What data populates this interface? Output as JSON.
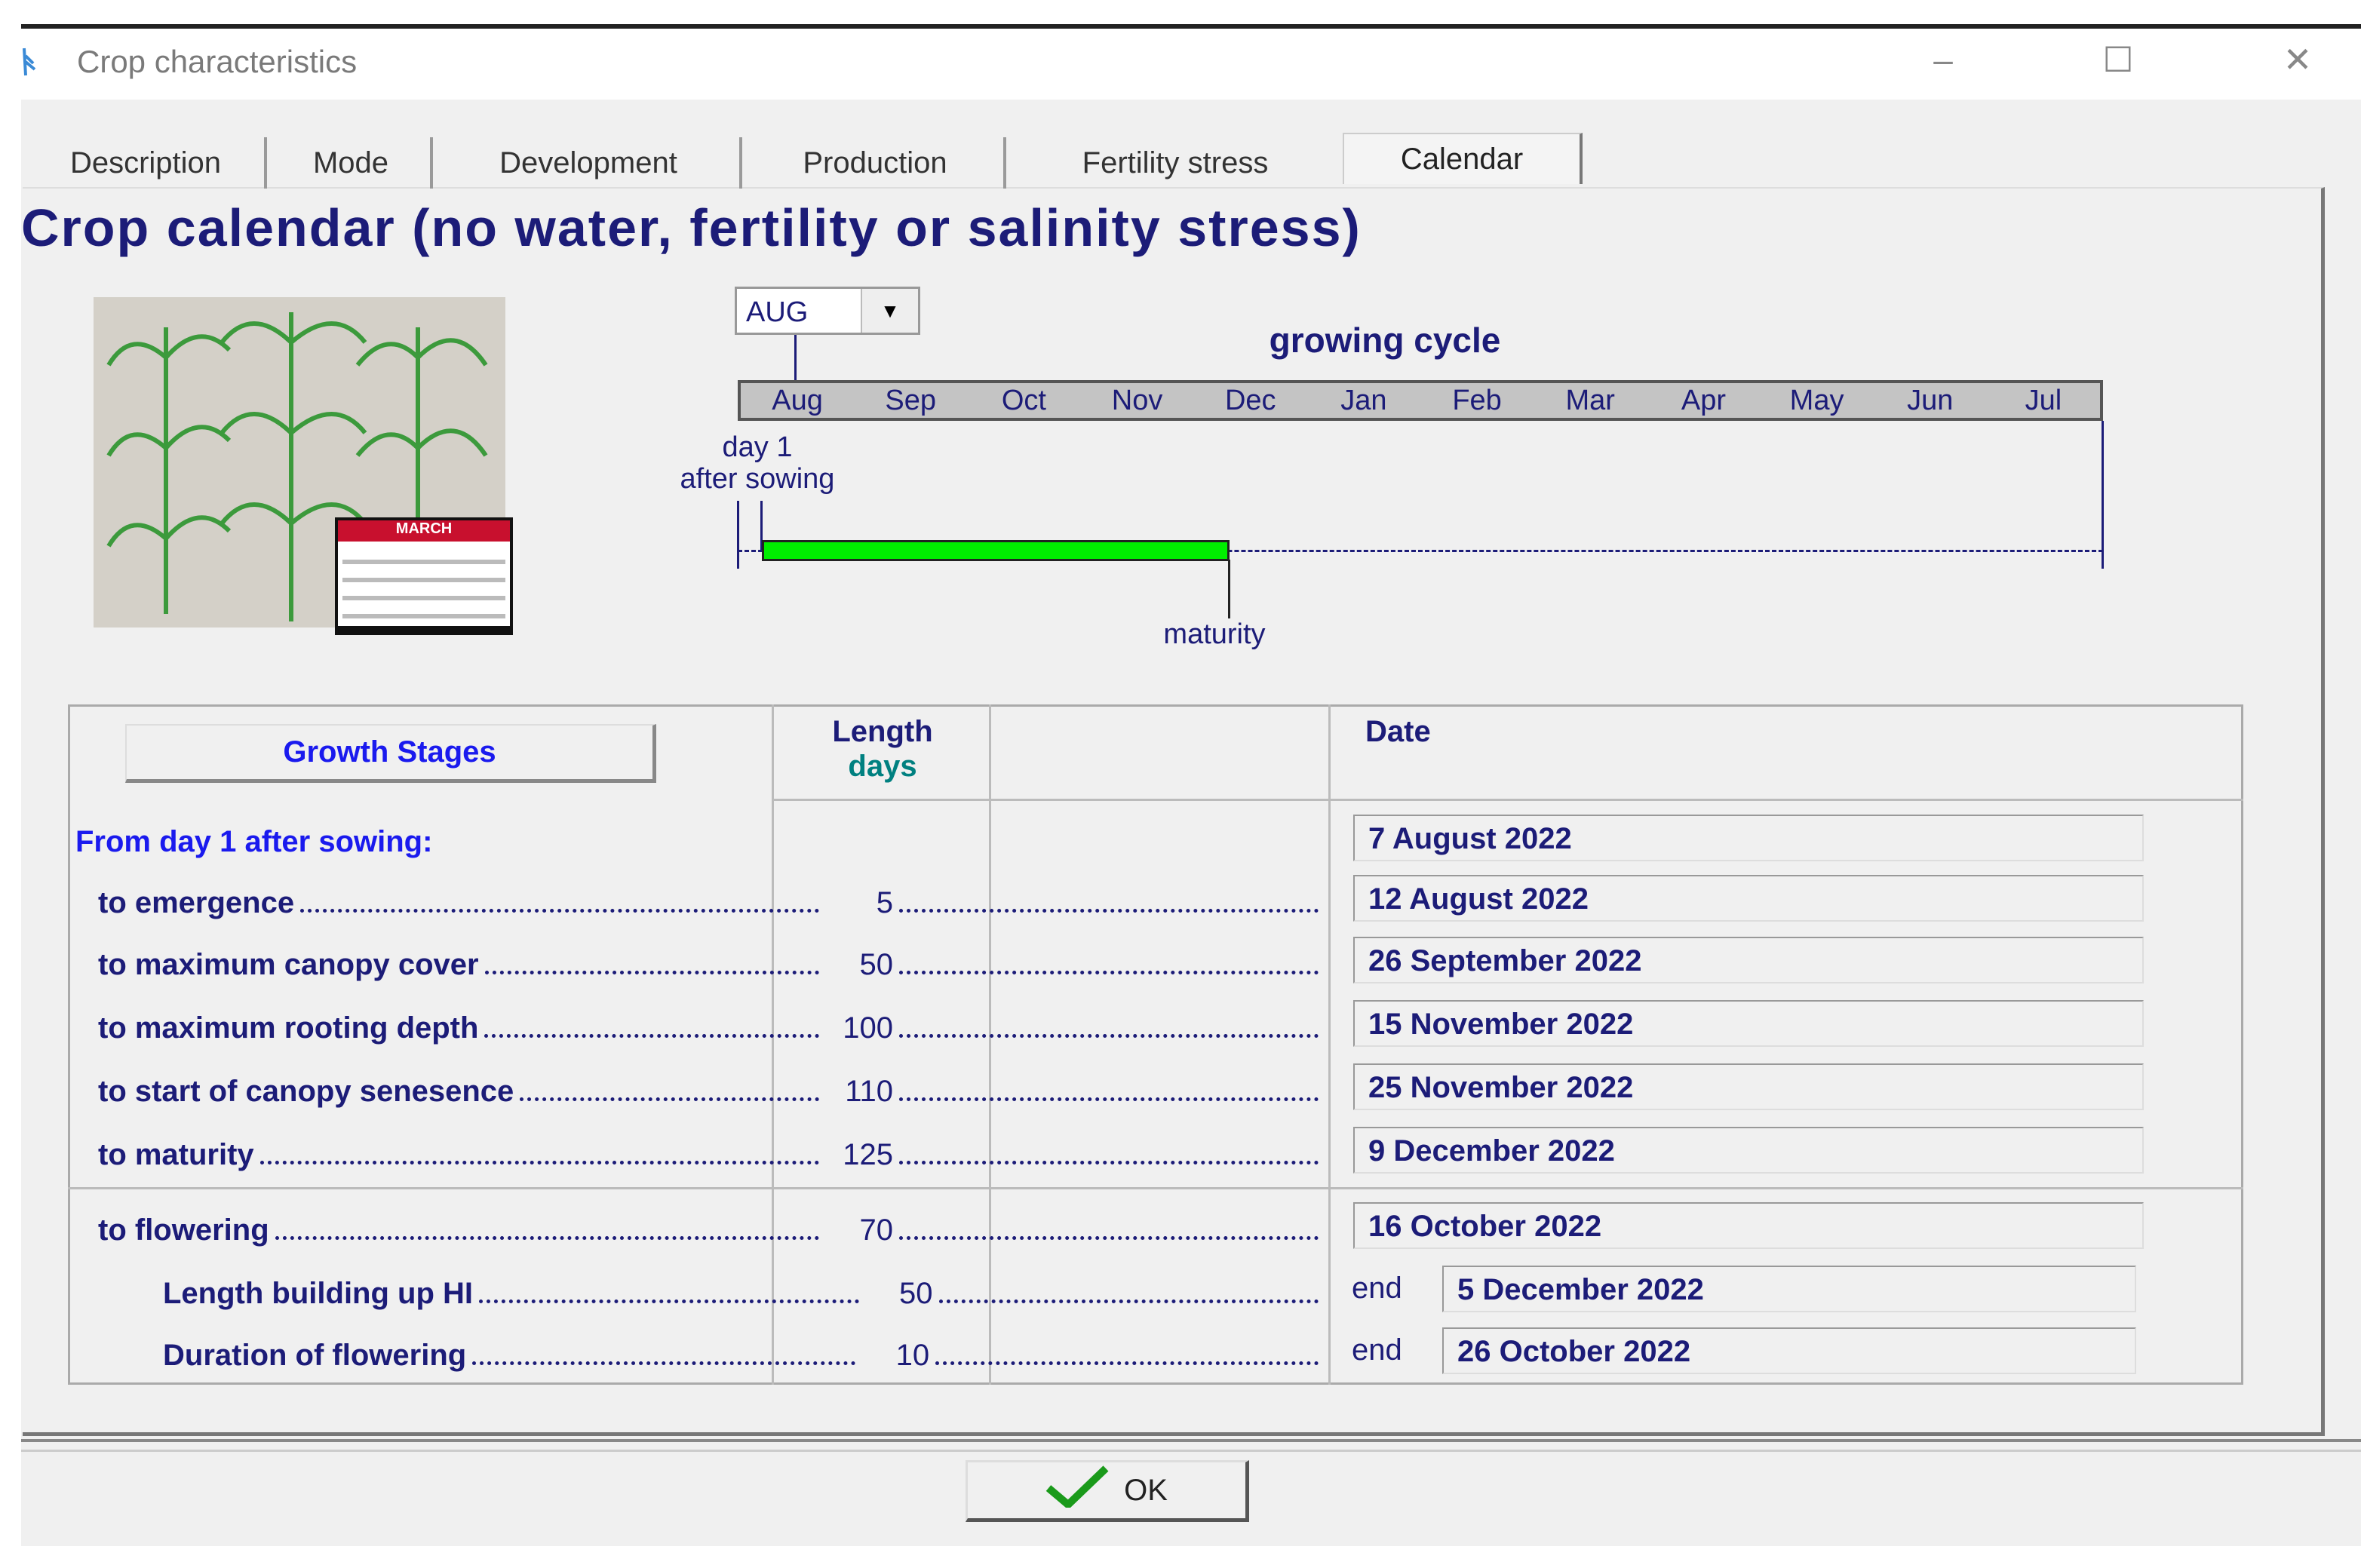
{
  "window": {
    "title": "Crop characteristics",
    "minimize": "–",
    "maximize": "☐",
    "close": "✕"
  },
  "tabs": [
    {
      "label": "Description"
    },
    {
      "label": "Mode"
    },
    {
      "label": "Development"
    },
    {
      "label": "Production"
    },
    {
      "label": "Fertility stress"
    },
    {
      "label": "Calendar",
      "selected": true
    }
  ],
  "heading": "Crop calendar (no water, fertility or salinity stress)",
  "calendar_icon": {
    "month": "MARCH"
  },
  "start_month": {
    "value": "AUG"
  },
  "timeline": {
    "title": "growing cycle",
    "months": [
      "Aug",
      "Sep",
      "Oct",
      "Nov",
      "Dec",
      "Jan",
      "Feb",
      "Mar",
      "Apr",
      "May",
      "Jun",
      "Jul"
    ],
    "start_label_1": "day 1",
    "start_label_2": "after sowing",
    "end_label": "maturity",
    "cycle_days": 125,
    "bar_color": "#00ee00"
  },
  "table": {
    "growth_stages_button": "Growth Stages",
    "length_header": "Length",
    "days_header": "days",
    "date_header": "Date",
    "from_label": "From day 1 after sowing:",
    "sowing_date": "7 August 2022",
    "rows": [
      {
        "label": "to emergence",
        "days": "5",
        "date": "12 August 2022"
      },
      {
        "label": "to maximum canopy cover",
        "days": "50",
        "date": "26 September 2022"
      },
      {
        "label": "to maximum rooting depth",
        "days": "100",
        "date": "15 November 2022"
      },
      {
        "label": "to start of canopy senesence",
        "days": "110",
        "date": "25 November 2022"
      },
      {
        "label": "to maturity",
        "days": "125",
        "date": "9 December 2022"
      },
      {
        "label": "to flowering",
        "days": "70",
        "date": "16 October 2022"
      },
      {
        "label": "Length building up HI",
        "days": "50",
        "prefix": "end",
        "date": "5 December 2022"
      },
      {
        "label": "Duration of flowering",
        "days": "10",
        "prefix": "end",
        "date": "26 October 2022"
      }
    ]
  },
  "ok_button": "OK"
}
